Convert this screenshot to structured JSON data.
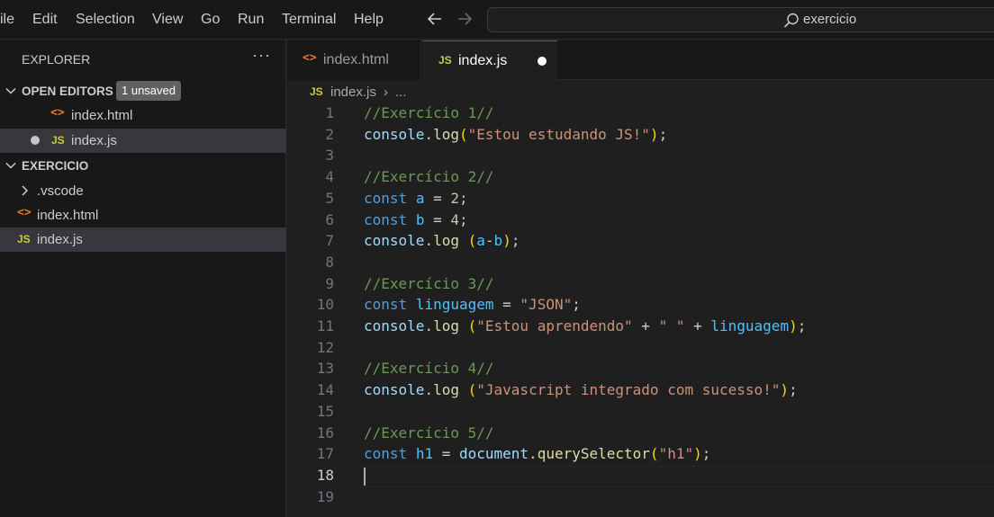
{
  "menu": [
    "ile",
    "Edit",
    "Selection",
    "View",
    "Go",
    "Run",
    "Terminal",
    "Help"
  ],
  "search": {
    "text": "exercicio"
  },
  "explorer": {
    "title": "EXPLORER",
    "more": "···",
    "open_editors": {
      "label": "OPEN EDITORS",
      "badge": "1 unsaved",
      "files": [
        "index.html",
        "index.js"
      ]
    },
    "workspace": {
      "label": "EXERCICIO",
      "folder": ".vscode",
      "files": [
        "index.html",
        "index.js"
      ]
    }
  },
  "tabs": [
    {
      "label": "index.html",
      "active": false
    },
    {
      "label": "index.js",
      "active": true,
      "modified": true
    }
  ],
  "breadcrumb": {
    "file": "index.js",
    "sep": "›",
    "rest": "..."
  },
  "icons": {
    "html": "html-file-icon",
    "js": "js-file-icon"
  },
  "line_numbers": [
    "1",
    "2",
    "3",
    "4",
    "5",
    "6",
    "7",
    "8",
    "9",
    "10",
    "11",
    "12",
    "13",
    "14",
    "15",
    "16",
    "17",
    "18",
    "19"
  ],
  "active_line": 18,
  "code": [
    [
      {
        "t": "//Exercício 1//",
        "c": "com"
      }
    ],
    [
      {
        "t": "console",
        "c": "id"
      },
      {
        "t": ".",
        "c": "plain"
      },
      {
        "t": "log",
        "c": "fn"
      },
      {
        "t": "(",
        "c": "br"
      },
      {
        "t": "\"Estou estudando JS!\"",
        "c": "str"
      },
      {
        "t": ")",
        "c": "br"
      },
      {
        "t": ";",
        "c": "plain"
      }
    ],
    [],
    [
      {
        "t": "//Exercício 2//",
        "c": "com"
      }
    ],
    [
      {
        "t": "const",
        "c": "kw"
      },
      {
        "t": " ",
        "c": "plain"
      },
      {
        "t": "a",
        "c": "var"
      },
      {
        "t": " = ",
        "c": "plain"
      },
      {
        "t": "2",
        "c": "num"
      },
      {
        "t": ";",
        "c": "plain"
      }
    ],
    [
      {
        "t": "const",
        "c": "kw"
      },
      {
        "t": " ",
        "c": "plain"
      },
      {
        "t": "b",
        "c": "var"
      },
      {
        "t": " = ",
        "c": "plain"
      },
      {
        "t": "4",
        "c": "num"
      },
      {
        "t": ";",
        "c": "plain"
      }
    ],
    [
      {
        "t": "console",
        "c": "id"
      },
      {
        "t": ".",
        "c": "plain"
      },
      {
        "t": "log",
        "c": "fn"
      },
      {
        "t": " ",
        "c": "plain"
      },
      {
        "t": "(",
        "c": "br"
      },
      {
        "t": "a",
        "c": "var"
      },
      {
        "t": "-",
        "c": "plain"
      },
      {
        "t": "b",
        "c": "var"
      },
      {
        "t": ")",
        "c": "br"
      },
      {
        "t": ";",
        "c": "plain"
      }
    ],
    [],
    [
      {
        "t": "//Exercício 3//",
        "c": "com"
      }
    ],
    [
      {
        "t": "const",
        "c": "kw"
      },
      {
        "t": " ",
        "c": "plain"
      },
      {
        "t": "linguagem",
        "c": "var"
      },
      {
        "t": " = ",
        "c": "plain"
      },
      {
        "t": "\"JSON\"",
        "c": "str"
      },
      {
        "t": ";",
        "c": "plain"
      }
    ],
    [
      {
        "t": "console",
        "c": "id"
      },
      {
        "t": ".",
        "c": "plain"
      },
      {
        "t": "log",
        "c": "fn"
      },
      {
        "t": " ",
        "c": "plain"
      },
      {
        "t": "(",
        "c": "br"
      },
      {
        "t": "\"Estou aprendendo\"",
        "c": "str"
      },
      {
        "t": " + ",
        "c": "plain"
      },
      {
        "t": "\" \"",
        "c": "str"
      },
      {
        "t": " + ",
        "c": "plain"
      },
      {
        "t": "linguagem",
        "c": "var"
      },
      {
        "t": ")",
        "c": "br"
      },
      {
        "t": ";",
        "c": "plain"
      }
    ],
    [],
    [
      {
        "t": "//Exercício 4//",
        "c": "com"
      }
    ],
    [
      {
        "t": "console",
        "c": "id"
      },
      {
        "t": ".",
        "c": "plain"
      },
      {
        "t": "log",
        "c": "fn"
      },
      {
        "t": " ",
        "c": "plain"
      },
      {
        "t": "(",
        "c": "br"
      },
      {
        "t": "\"Javascript integrado com sucesso!\"",
        "c": "str"
      },
      {
        "t": ")",
        "c": "br"
      },
      {
        "t": ";",
        "c": "plain"
      }
    ],
    [],
    [
      {
        "t": "//Exercício 5//",
        "c": "com"
      }
    ],
    [
      {
        "t": "const",
        "c": "kw"
      },
      {
        "t": " ",
        "c": "plain"
      },
      {
        "t": "h1",
        "c": "var"
      },
      {
        "t": " = ",
        "c": "plain"
      },
      {
        "t": "document",
        "c": "id"
      },
      {
        "t": ".",
        "c": "plain"
      },
      {
        "t": "querySelector",
        "c": "fn"
      },
      {
        "t": "(",
        "c": "br"
      },
      {
        "t": "\"h1\"",
        "c": "str"
      },
      {
        "t": ")",
        "c": "br"
      },
      {
        "t": ";",
        "c": "plain"
      }
    ],
    [],
    []
  ]
}
